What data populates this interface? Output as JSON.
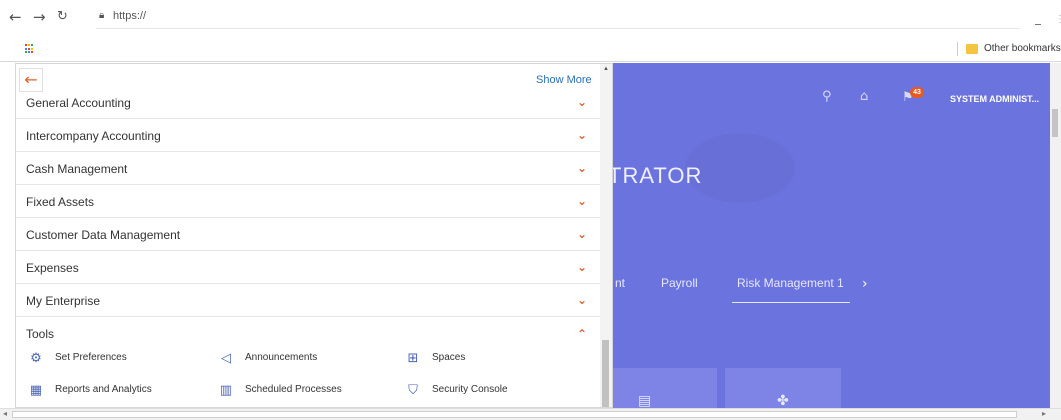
{
  "browser": {
    "url": "https://",
    "bookmark_label": "Other bookmarks"
  },
  "app": {
    "user_label": "SYSTEM ADMINIST...",
    "notification_count": "43",
    "heading": "TRATOR",
    "tabs": [
      {
        "label": "nt"
      },
      {
        "label": "Payroll"
      },
      {
        "label": "Risk Management 1"
      }
    ]
  },
  "panel": {
    "show_more": "Show More",
    "categories": [
      {
        "label": "General Accounting",
        "expanded": false
      },
      {
        "label": "Intercompany Accounting",
        "expanded": false
      },
      {
        "label": "Cash Management",
        "expanded": false
      },
      {
        "label": "Fixed Assets",
        "expanded": false
      },
      {
        "label": "Customer Data Management",
        "expanded": false
      },
      {
        "label": "Expenses",
        "expanded": false
      },
      {
        "label": "My Enterprise",
        "expanded": false
      },
      {
        "label": "Tools",
        "expanded": true
      }
    ],
    "tools": [
      {
        "label": "Set Preferences",
        "icon": "preferences-icon"
      },
      {
        "label": "Announcements",
        "icon": "megaphone-icon"
      },
      {
        "label": "Spaces",
        "icon": "spaces-icon"
      },
      {
        "label": "Reports and Analytics",
        "icon": "reports-icon"
      },
      {
        "label": "Scheduled Processes",
        "icon": "calendar-icon"
      },
      {
        "label": "Security Console",
        "icon": "shield-icon"
      }
    ]
  },
  "colors": {
    "accent": "#e06129",
    "app_background": "#6b73df",
    "link": "#2b6fb8"
  }
}
